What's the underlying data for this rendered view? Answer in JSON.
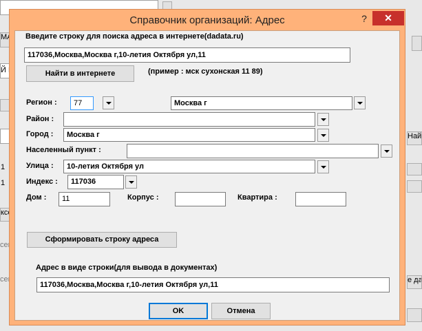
{
  "background_app": {
    "frag_1": "МАНА",
    "frag_2": "Й Н",
    "frag_3": "1",
    "frag_4": "1",
    "frag_5": "ксе",
    "frag_6": "сего",
    "frag_7": "сего",
    "frag_8": "Найт",
    "frag_9": "е да"
  },
  "dialog": {
    "title": "Справочник организаций: Адрес",
    "help_symbol": "?",
    "close_symbol": "✕",
    "search": {
      "label": "Введите строку для поиска адреса в интернете(dadata.ru)",
      "value": "117036,Москва,Москва г,10-летия Октября ул,11",
      "button": "Найти в интернете",
      "example": "(пример   :  мск сухонская 11 89)"
    },
    "region": {
      "label": "Регион  :",
      "code": "77",
      "name": "Москва г"
    },
    "district": {
      "label": "Район  :",
      "value": ""
    },
    "city": {
      "label": "Город  :",
      "value": "Москва г"
    },
    "settlement": {
      "label": "Населенный пункт    :",
      "value": ""
    },
    "street": {
      "label": "Улица  :",
      "value": "10-летия Октября ул"
    },
    "index": {
      "label": "Индекс  :",
      "value": "117036"
    },
    "house": {
      "label": "Дом :",
      "value": "11"
    },
    "building": {
      "label": "Корпус  :",
      "value": ""
    },
    "apartment": {
      "label": "Квартира  :",
      "value": ""
    },
    "form_button": "Сформировать строку адреса",
    "address_line": {
      "label": "Адрес в виде строки(для вывода в документах)",
      "value": "117036,Москва,Москва г,10-летия Октября ул,11"
    },
    "ok": "OK",
    "cancel": "Отмена"
  }
}
